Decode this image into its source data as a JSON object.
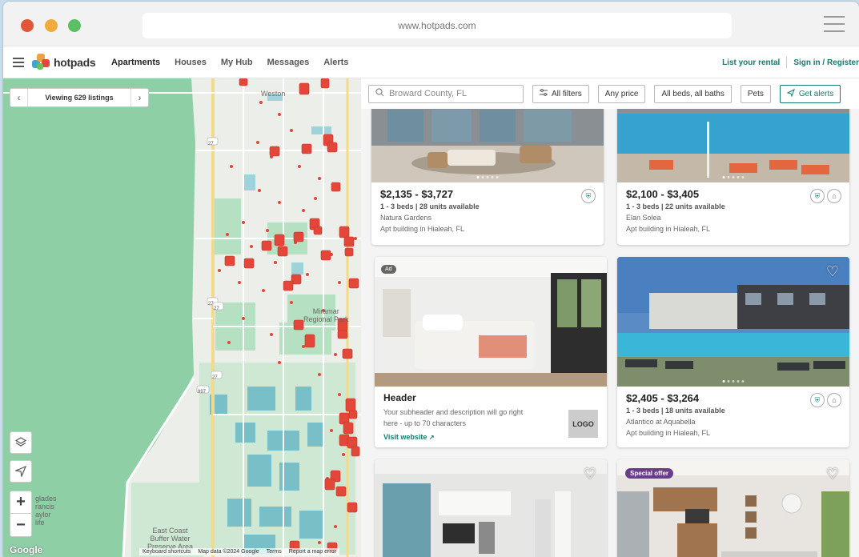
{
  "browser": {
    "url": "www.hotpads.com"
  },
  "nav": {
    "logo_text": "hotpads",
    "links": [
      "Apartments",
      "Houses",
      "My Hub",
      "Messages",
      "Alerts"
    ],
    "list_rental": "List your rental",
    "sign_in": "Sign in / Register"
  },
  "map": {
    "viewing_label": "Viewing 629 listings",
    "labels": {
      "weston": "Weston",
      "miramar": "Miramar\nRegional Park",
      "glades": "glades\nrancis\naylor\nlife",
      "eastcoast": "East Coast\nBuffer Water\nPreserve Area"
    },
    "road_shields": [
      "27",
      "27",
      "27",
      "27",
      "997"
    ],
    "google": "Google",
    "footer": [
      "Keyboard shortcuts",
      "Map data ©2024 Google",
      "Terms",
      "Report a map error"
    ]
  },
  "filters": {
    "search_placeholder": "Broward County, FL",
    "all_filters": "All filters",
    "price": "Any price",
    "beds": "All beds, all baths",
    "pets": "Pets",
    "alerts": "Get alerts"
  },
  "listings": [
    {
      "price": "$2,135 - $3,727",
      "beds": "1 - 3 beds | 28 units available",
      "name": "Natura Gardens",
      "type": "Apt building in Hialeah, FL"
    },
    {
      "price": "$2,100 - $3,405",
      "beds": "1 - 3 beds | 22 units available",
      "name": "Elan Solea",
      "type": "Apt building in Hialeah, FL"
    },
    {
      "ad_tag": "Ad",
      "header": "Header",
      "subheader": "Your subheader and description will go right here - up to 70 characters",
      "link": "Visit website",
      "logo": "LOGO"
    },
    {
      "price": "$2,405 - $3,264",
      "beds": "1 - 3 beds | 18 units available",
      "name": "Atlantico at Aquabella",
      "type": "Apt building in Hialeah, FL"
    },
    {},
    {
      "special": "Special offer"
    }
  ],
  "colors": {
    "accent": "#167a6e",
    "pin": "#e2473a",
    "map_green": "#8fcfa6"
  }
}
